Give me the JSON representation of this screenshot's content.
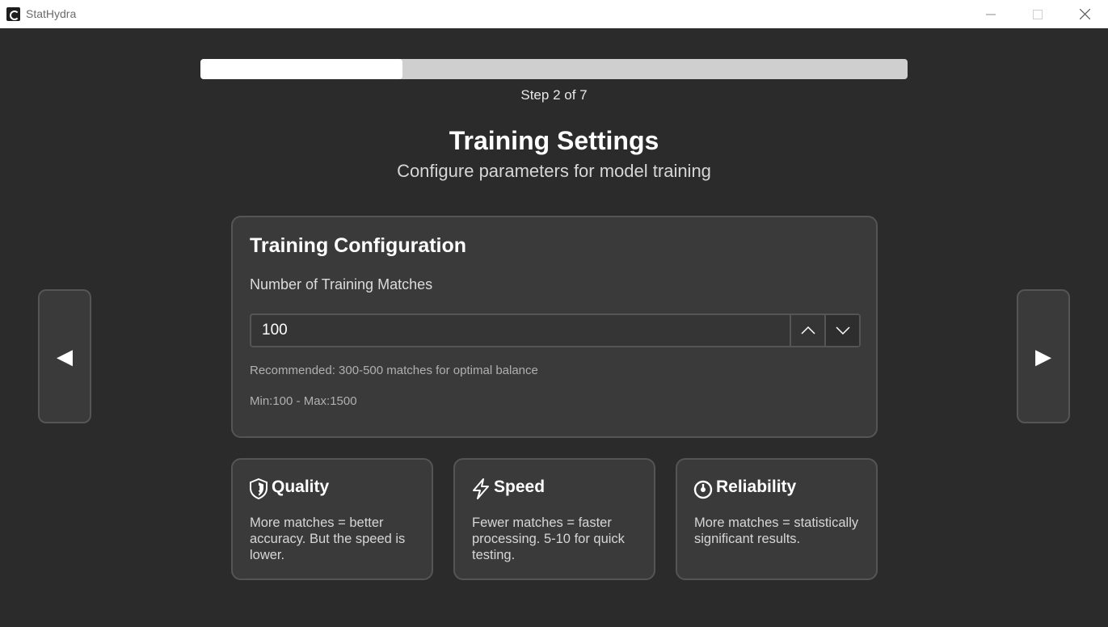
{
  "window": {
    "title": "StatHydra",
    "icon": "app-logo-icon",
    "controls": [
      "minimize-icon",
      "maximize-icon",
      "close-icon"
    ]
  },
  "progress": {
    "step_label": "Step 2 of 7",
    "current_step": 2,
    "total_steps": 7,
    "fill_fraction": 0.2857
  },
  "header": {
    "title": "Training Settings",
    "subtitle": "Configure parameters for model training"
  },
  "navigation": {
    "prev_glyph": "◀",
    "next_glyph": "▶"
  },
  "config": {
    "title": "Training Configuration",
    "field_label": "Number of Training Matches",
    "value": "100",
    "recommendation": "Recommended: 300-500 matches for optimal balance",
    "range": "Min:100 - Max:1500"
  },
  "info_cards": [
    {
      "icon": "shield-icon",
      "title": "Quality",
      "text": "More matches = better accuracy. But the speed is lower."
    },
    {
      "icon": "lightning-icon",
      "title": "Speed",
      "text": "Fewer matches = faster processing. 5-10 for quick testing."
    },
    {
      "icon": "gauge-icon",
      "title": "Reliability",
      "text": "More matches = statistically significant results."
    }
  ],
  "colors": {
    "background": "#2b2b2b",
    "card": "#3a3a3a",
    "border": "#555555",
    "progress_fill": "#ffffff",
    "progress_track": "#cfcfcf"
  }
}
